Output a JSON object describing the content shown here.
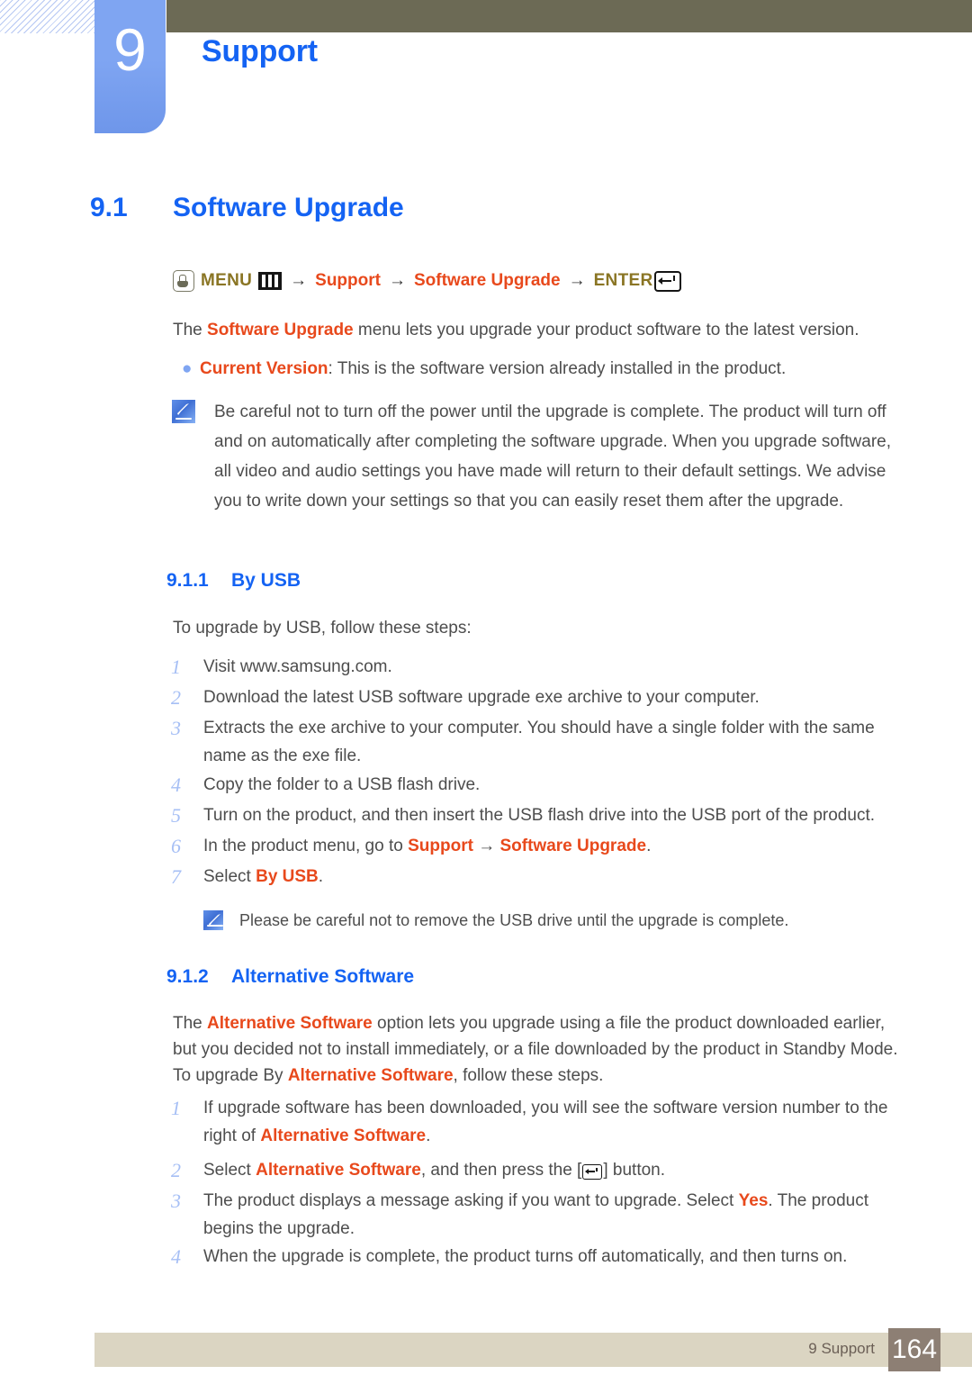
{
  "chapter": {
    "number": "9",
    "title": "Support"
  },
  "section": {
    "number": "9.1",
    "title": "Software Upgrade"
  },
  "menu_path": {
    "hand_icon": "hand-press-icon",
    "menu_label": "MENU",
    "menu_icon": "menu-bars-icon",
    "arrow": "→",
    "item1": "Support",
    "item2": "Software Upgrade",
    "enter_label": "ENTER",
    "enter_icon": "enter-key-icon"
  },
  "intro": {
    "pre": "The ",
    "keyword": "Software Upgrade",
    "post": " menu lets you upgrade your product software to the latest version."
  },
  "bullet": {
    "marker": "●",
    "keyword": "Current Version",
    "text": ": This is the software version already installed in the product."
  },
  "note_main": {
    "icon": "note-pen-icon",
    "text": "Be careful not to turn off the power until the upgrade is complete. The product will turn off and on automatically after completing the software upgrade. When you upgrade software, all video and audio settings you have made will return to their default settings. We advise you to write down your settings so that you can easily reset them after the upgrade."
  },
  "subsection_usb": {
    "number": "9.1.1",
    "title": "By USB",
    "lead": "To upgrade by USB, follow these steps:",
    "steps": [
      {
        "n": "1",
        "text": "Visit www.samsung.com."
      },
      {
        "n": "2",
        "text": "Download the latest USB software upgrade exe archive to your computer."
      },
      {
        "n": "3",
        "text": "Extracts the exe archive to your computer. You should have a single folder with the same name as the exe file."
      },
      {
        "n": "4",
        "text": "Copy the folder to a USB flash drive."
      },
      {
        "n": "5",
        "text": "Turn on the product, and then insert the USB flash drive into the USB port of the product."
      },
      {
        "n": "6",
        "text": "In the product menu, go to ",
        "kw1": "Support",
        "mid": " → ",
        "kw2": "Software Upgrade",
        "tail": "."
      },
      {
        "n": "7",
        "text": "Select ",
        "kw1": "By USB",
        "tail": "."
      }
    ],
    "note": {
      "icon": "note-pen-icon",
      "text": "Please be careful not to remove the USB drive until the upgrade is complete."
    }
  },
  "subsection_alt": {
    "number": "9.1.2",
    "title": "Alternative Software",
    "intro": {
      "p1": "The ",
      "kw1": "Alternative Software",
      "p2": " option lets you upgrade using a file the product downloaded earlier, but you decided not to install immediately, or a file downloaded by the product in Standby Mode. To upgrade By ",
      "kw2": "Alternative Software",
      "p3": ", follow these steps."
    },
    "steps": [
      {
        "n": "1",
        "text": "If upgrade software has been downloaded, you will see the software version number to the right of ",
        "kw1": "Alternative Software",
        "tail": "."
      },
      {
        "n": "2",
        "text": "Select ",
        "kw1": "Alternative Software",
        "mid": ", and then press the [",
        "icon": "enter-key-icon",
        "tail": "] button."
      },
      {
        "n": "3",
        "text": "The product displays a message asking if you want to upgrade. Select ",
        "kw1": "Yes",
        "tail": ". The product begins the upgrade."
      },
      {
        "n": "4",
        "text": "When the upgrade is complete, the product turns off automatically, and then turns on."
      }
    ]
  },
  "footer": {
    "label": "9 Support",
    "page": "164"
  },
  "colors": {
    "heading_blue": "#1463f3",
    "keyword_orange": "#e8491c",
    "menu_gold": "#8a7524",
    "body_gray": "#4d4d4d",
    "tab_blue": "#7fa5f2",
    "topbar_olive": "#6c6a55",
    "footer_beige": "#dbd5c2",
    "footer_page_taupe": "#8d7f74"
  }
}
